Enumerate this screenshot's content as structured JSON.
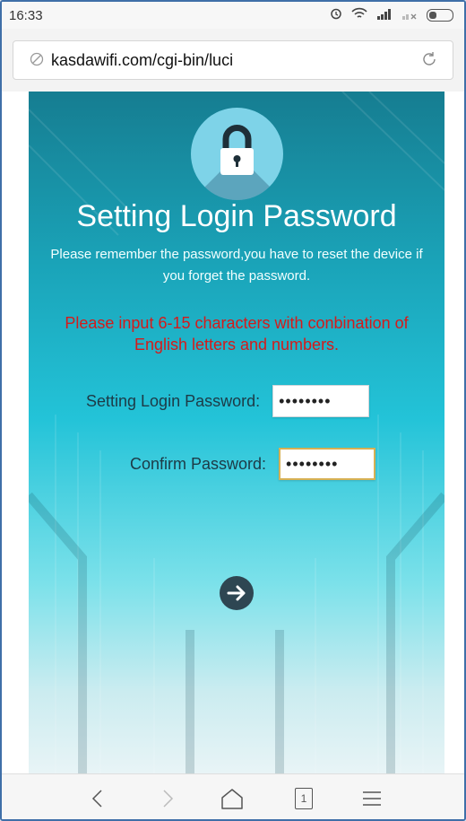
{
  "status_bar": {
    "time": "16:33",
    "icons": [
      "alarm-icon",
      "wifi-icon",
      "signal-icon",
      "signal-no-sim-icon",
      "battery-icon"
    ]
  },
  "browser": {
    "url": "kasdawifi.com/cgi-bin/luci",
    "tab_count": "1"
  },
  "page": {
    "title": "Setting Login Password",
    "subtitle": "Please remember the password,you have to reset the device if you forget the password.",
    "warning": "Please input 6-15 characters with conbination of English letters and numbers.",
    "fields": [
      {
        "label": "Setting Login Password:",
        "value": "••••••••"
      },
      {
        "label": "Confirm Password:",
        "value": "••••••••"
      }
    ]
  },
  "colors": {
    "warning": "#d61a1a",
    "background_top": "#167d91",
    "background_mid": "#23c3d8",
    "focus_border": "#d7b054"
  }
}
